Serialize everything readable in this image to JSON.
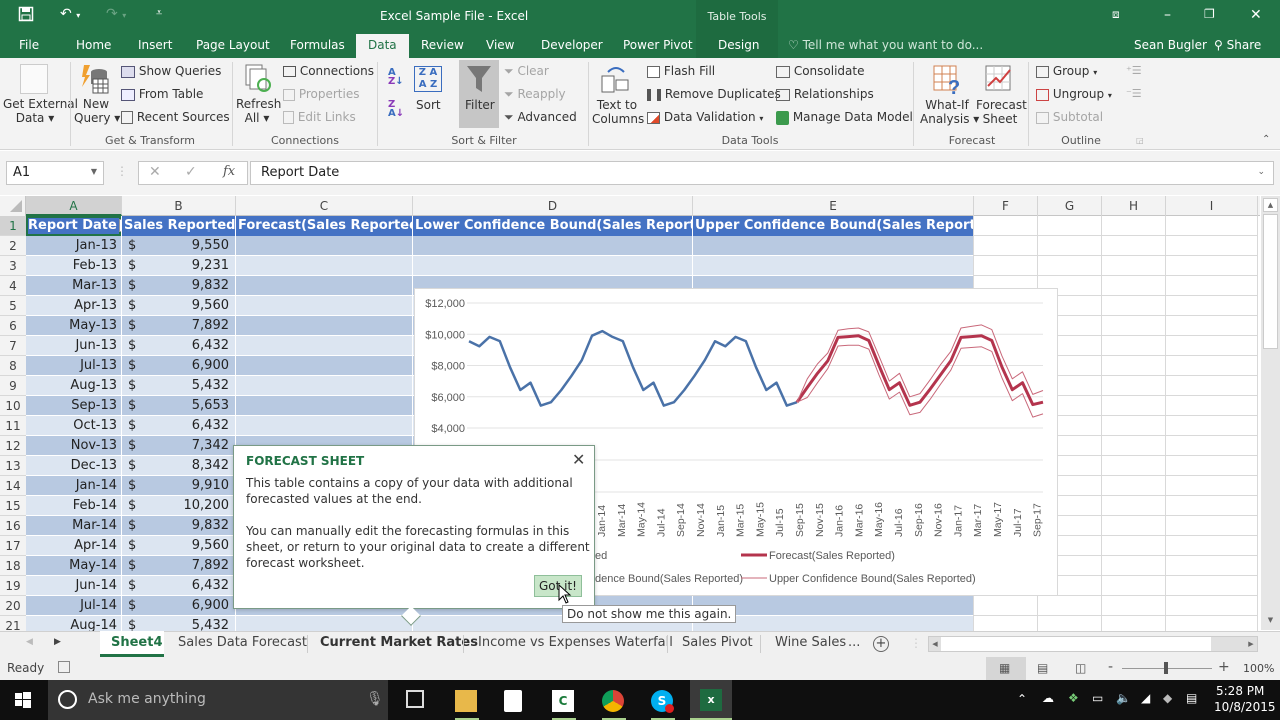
{
  "window": {
    "title": "Excel Sample File - Excel",
    "context_tab_group": "Table Tools",
    "user": "Sean Bugler",
    "share_label": "Share",
    "tell_me_placeholder": "Tell me what you want to do..."
  },
  "ribbon_tabs": [
    "File",
    "Home",
    "Insert",
    "Page Layout",
    "Formulas",
    "Data",
    "Review",
    "View",
    "Developer",
    "Power Pivot",
    "Design"
  ],
  "active_tab": "Data",
  "ribbon": {
    "groups": [
      {
        "label": "Get & Transform"
      },
      {
        "label": "Connections"
      },
      {
        "label": "Sort & Filter"
      },
      {
        "label": "Data Tools"
      },
      {
        "label": "Forecast"
      },
      {
        "label": "Outline"
      }
    ],
    "get_external_data": [
      "Get External",
      "Data ▾"
    ],
    "new_query": [
      "New",
      "Query ▾"
    ],
    "show_queries": "Show Queries",
    "from_table": "From Table",
    "recent_sources": "Recent Sources",
    "refresh_all": [
      "Refresh",
      "All ▾"
    ],
    "connections": "Connections",
    "properties": "Properties",
    "edit_links": "Edit Links",
    "sort": "Sort",
    "filter": "Filter",
    "clear": "Clear",
    "reapply": "Reapply",
    "advanced": "Advanced",
    "text_to_columns": [
      "Text to",
      "Columns"
    ],
    "flash_fill": "Flash Fill",
    "remove_duplicates": "Remove Duplicates",
    "data_validation": "Data Validation",
    "consolidate": "Consolidate",
    "relationships": "Relationships",
    "manage_data_model": "Manage Data Model",
    "what_if": [
      "What-If",
      "Analysis ▾"
    ],
    "forecast_sheet": [
      "Forecast",
      "Sheet"
    ],
    "group": "Group",
    "ungroup": "Ungroup",
    "subtotal": "Subtotal"
  },
  "formula_bar": {
    "name_box": "A1",
    "formula": "Report Date"
  },
  "columns": [
    "A",
    "B",
    "C",
    "D",
    "E",
    "F",
    "G",
    "H",
    "I"
  ],
  "table_headers": [
    "Report Date",
    "Sales Reported",
    "Forecast(Sales Reported)",
    "Lower Confidence Bound(Sales Reported)",
    "Upper Confidence Bound(Sales Reported)"
  ],
  "rows": [
    {
      "n": "1"
    },
    {
      "n": "2",
      "date": "Jan-13",
      "cur": "$",
      "val": "9,550"
    },
    {
      "n": "3",
      "date": "Feb-13",
      "cur": "$",
      "val": "9,231"
    },
    {
      "n": "4",
      "date": "Mar-13",
      "cur": "$",
      "val": "9,832"
    },
    {
      "n": "5",
      "date": "Apr-13",
      "cur": "$",
      "val": "9,560"
    },
    {
      "n": "6",
      "date": "May-13",
      "cur": "$",
      "val": "7,892"
    },
    {
      "n": "7",
      "date": "Jun-13",
      "cur": "$",
      "val": "6,432"
    },
    {
      "n": "8",
      "date": "Jul-13",
      "cur": "$",
      "val": "6,900"
    },
    {
      "n": "9",
      "date": "Aug-13",
      "cur": "$",
      "val": "5,432"
    },
    {
      "n": "10",
      "date": "Sep-13",
      "cur": "$",
      "val": "5,653"
    },
    {
      "n": "11",
      "date": "Oct-13",
      "cur": "$",
      "val": "6,432"
    },
    {
      "n": "12",
      "date": "Nov-13",
      "cur": "$",
      "val": "7,342"
    },
    {
      "n": "13",
      "date": "Dec-13",
      "cur": "$",
      "val": "8,342"
    },
    {
      "n": "14",
      "date": "Jan-14",
      "cur": "$",
      "val": "9,910"
    },
    {
      "n": "15",
      "date": "Feb-14",
      "cur": "$",
      "val": "10,200"
    },
    {
      "n": "16",
      "date": "Mar-14",
      "cur": "$",
      "val": "9,832"
    },
    {
      "n": "17",
      "date": "Apr-14",
      "cur": "$",
      "val": "9,560"
    },
    {
      "n": "18",
      "date": "May-14",
      "cur": "$",
      "val": "7,892"
    },
    {
      "n": "19",
      "date": "Jun-14",
      "cur": "$",
      "val": "6,432"
    },
    {
      "n": "20",
      "date": "Jul-14",
      "cur": "$",
      "val": "6,900"
    },
    {
      "n": "21",
      "date": "Aug-14",
      "cur": "$",
      "val": "5,432"
    }
  ],
  "chart_data": {
    "type": "line",
    "y_ticks": [
      "$12,000",
      "$10,000",
      "$8,000",
      "$6,000",
      "$4,000"
    ],
    "ylim": [
      4000,
      12000
    ],
    "x_tick_labels_visible": [
      "Jan-14",
      "Mar-14",
      "May-14",
      "Jul-14",
      "Sep-14",
      "Nov-14",
      "Jan-15",
      "Mar-15",
      "May-15",
      "Jul-15",
      "Sep-15",
      "Nov-15",
      "Jan-16",
      "Mar-16",
      "May-16",
      "Jul-16",
      "Sep-16",
      "Nov-16",
      "Jan-17",
      "Mar-17",
      "May-17",
      "Jul-17",
      "Sep-17"
    ],
    "series": [
      {
        "name": "Sales Reported",
        "color": "#4a72a8",
        "values": [
          9550,
          9231,
          9832,
          9560,
          7892,
          6432,
          6900,
          5432,
          5653,
          6432,
          7342,
          8342,
          9910,
          10200,
          9832,
          9560,
          7892,
          6432,
          6900,
          5432,
          5653,
          6432,
          7342,
          8342,
          9550,
          9231,
          9832,
          9560,
          7892,
          6432,
          6900,
          5432,
          5653
        ]
      },
      {
        "name": "Forecast(Sales Reported)",
        "color": "#b4344d",
        "start_index": 32,
        "values": [
          5653,
          6600,
          7500,
          8300,
          9800,
          9850,
          9900,
          9600,
          8000,
          6450,
          6900,
          5450,
          5650,
          6500,
          7400,
          8300,
          9800,
          9850,
          9900,
          9600,
          7900,
          6450,
          6900,
          5500,
          5650
        ]
      },
      {
        "name": "Lower Confidence Bound(Sales Reported)",
        "color": "#c9687a",
        "start_index": 32,
        "values": [
          5653,
          5950,
          6900,
          7800,
          9250,
          9300,
          9300,
          9050,
          7400,
          5850,
          6300,
          4850,
          5000,
          5850,
          6800,
          7700,
          9100,
          9150,
          9200,
          8900,
          7200,
          5750,
          6200,
          4700,
          4900
        ]
      },
      {
        "name": "Upper Confidence Bound(Sales Reported)",
        "color": "#c9687a",
        "start_index": 32,
        "values": [
          5653,
          7150,
          8100,
          8800,
          10250,
          10350,
          10400,
          10150,
          8600,
          7000,
          7500,
          6000,
          6200,
          7100,
          8050,
          8900,
          10400,
          10500,
          10600,
          10300,
          8600,
          7150,
          7600,
          6150,
          6400
        ]
      }
    ],
    "legend": [
      "Sales Reported",
      "Forecast(Sales Reported)",
      "Lower Confidence Bound(Sales Reported)",
      "Upper Confidence Bound(Sales Reported)"
    ],
    "legend_visible_fragments": [
      "ed",
      "Forecast(Sales Reported)",
      "dence Bound(Sales Reported)",
      "Upper Confidence Bound(Sales Reported)"
    ]
  },
  "dialog": {
    "title": "FORECAST SHEET",
    "para1": "This table contains a copy of your data with additional forecasted values at the end.",
    "para2": "You can manually edit the forecasting formulas in this sheet, or return to your original data to create a different forecast worksheet.",
    "button": "Got it!",
    "tooltip": "Do not show me this again."
  },
  "sheet_tabs": [
    "Sheet4",
    "Sales Data Forecast",
    "Current Market Rates",
    "Income vs Expenses Waterfall",
    "Sales Pivot",
    "Wine Sales"
  ],
  "active_sheet": "Sheet4",
  "status": {
    "ready": "Ready",
    "zoom": "100%",
    "more_sheets": "..."
  },
  "taskbar": {
    "search_placeholder": "Ask me anything",
    "time": "5:28 PM",
    "date": "10/8/2015"
  },
  "colors": {
    "excel_green": "#217346",
    "table_header": "#4472c4",
    "band_dark": "#b8c9e1",
    "band_light": "#dce5f1"
  }
}
